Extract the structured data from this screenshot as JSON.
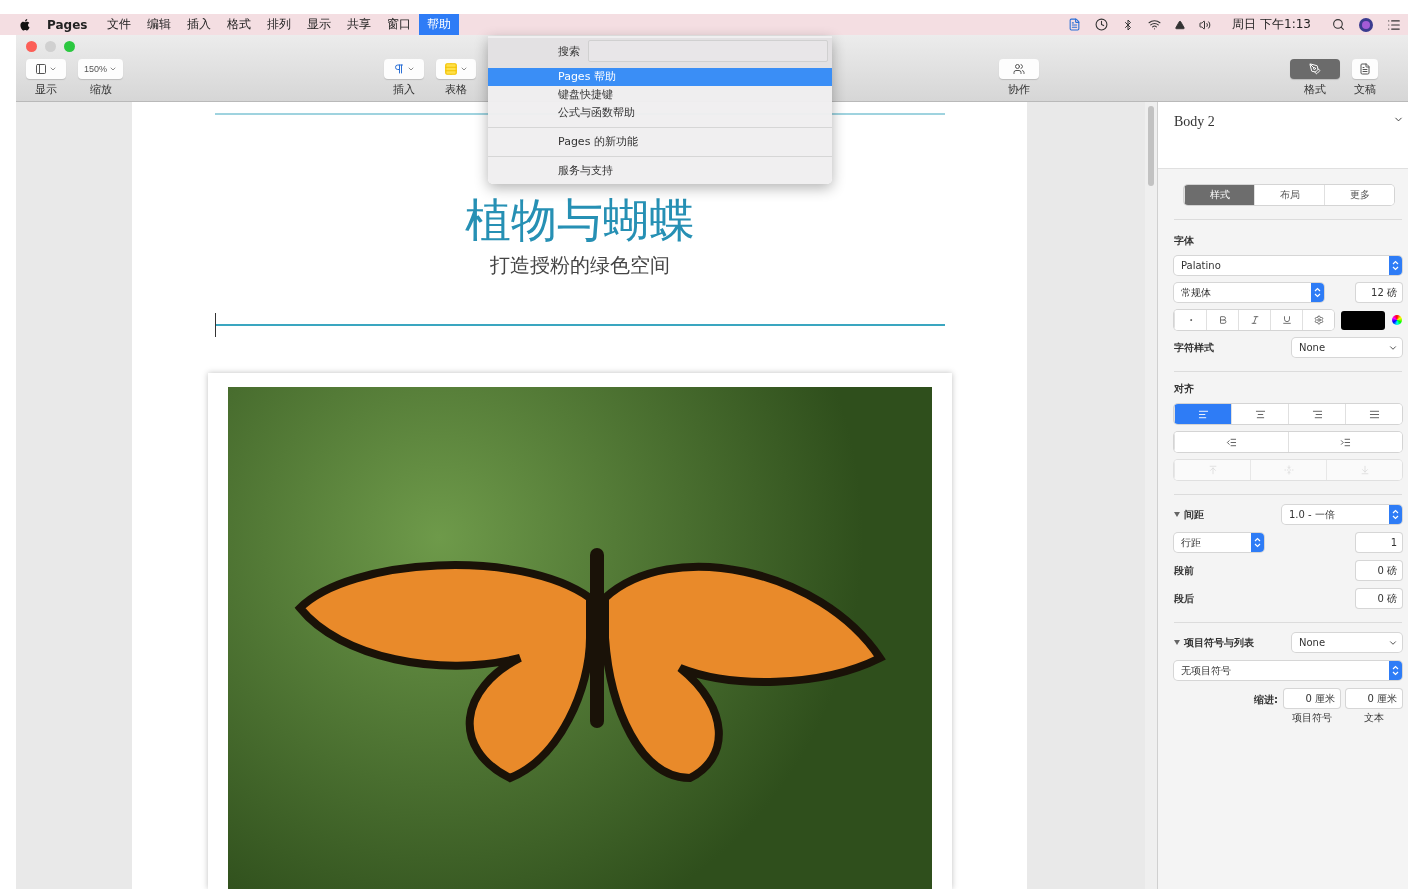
{
  "menu_bar": {
    "app": "Pages",
    "menus": [
      {
        "label": "文件",
        "selected": false
      },
      {
        "label": "编辑",
        "selected": false
      },
      {
        "label": "插入",
        "selected": false
      },
      {
        "label": "格式",
        "selected": false
      },
      {
        "label": "排列",
        "selected": false
      },
      {
        "label": "显示",
        "selected": false
      },
      {
        "label": "共享",
        "selected": false
      },
      {
        "label": "窗口",
        "selected": false
      },
      {
        "label": "帮助",
        "selected": true
      }
    ],
    "clock": "周日 下午1:13"
  },
  "toolbar": {
    "left": [
      {
        "kind": "view",
        "label": "显示"
      },
      {
        "kind": "zoom",
        "value": "150%",
        "label": "缩放"
      }
    ],
    "middle": [
      {
        "kind": "insert",
        "label": "插入"
      },
      {
        "kind": "table",
        "label": "表格"
      }
    ],
    "collaborate": {
      "label": "协作"
    },
    "right": [
      {
        "label": "格式",
        "selected": true
      },
      {
        "label": "文稿",
        "selected": false
      }
    ]
  },
  "help_menu": {
    "search_label": "搜索",
    "groups": [
      [
        {
          "label": "Pages 帮助",
          "selected": true
        },
        {
          "label": "键盘快捷键",
          "selected": false
        },
        {
          "label": "公式与函数帮助",
          "selected": false
        }
      ],
      [
        {
          "label": "Pages 的新功能",
          "selected": false
        }
      ],
      [
        {
          "label": "服务与支持",
          "selected": false
        }
      ]
    ]
  },
  "document": {
    "title": "植物与蝴蝶",
    "subtitle": "打造授粉的绿色空间"
  },
  "sidebar": {
    "paragraph_style": "Body 2",
    "tabs": [
      {
        "label": "样式",
        "selected": true
      },
      {
        "label": "布局",
        "selected": false
      },
      {
        "label": "更多",
        "selected": false
      }
    ],
    "font": {
      "label": "字体",
      "family": "Palatino",
      "typeface": "常规体",
      "size": "12 磅",
      "char_style_label": "字符样式",
      "char_style": "None"
    },
    "alignment": {
      "label": "对齐",
      "options": [
        {
          "selected": true
        },
        {
          "selected": false
        },
        {
          "selected": false
        },
        {
          "selected": false
        }
      ],
      "vertical_disabled": true
    },
    "spacing": {
      "label": "间距",
      "expanded": true,
      "value": "1.0 - 一倍",
      "mode": "行距",
      "mode_value": "1",
      "before_label": "段前",
      "before": "0 磅",
      "after_label": "段后",
      "after": "0 磅"
    },
    "bullets": {
      "label": "项目符号与列表",
      "expanded": true,
      "value": "None",
      "style": "无项目符号",
      "indent_label": "缩进:",
      "bullet_indent": "0 厘米",
      "bullet_caption": "项目符号",
      "text_indent": "0 厘米",
      "text_caption": "文本"
    }
  }
}
